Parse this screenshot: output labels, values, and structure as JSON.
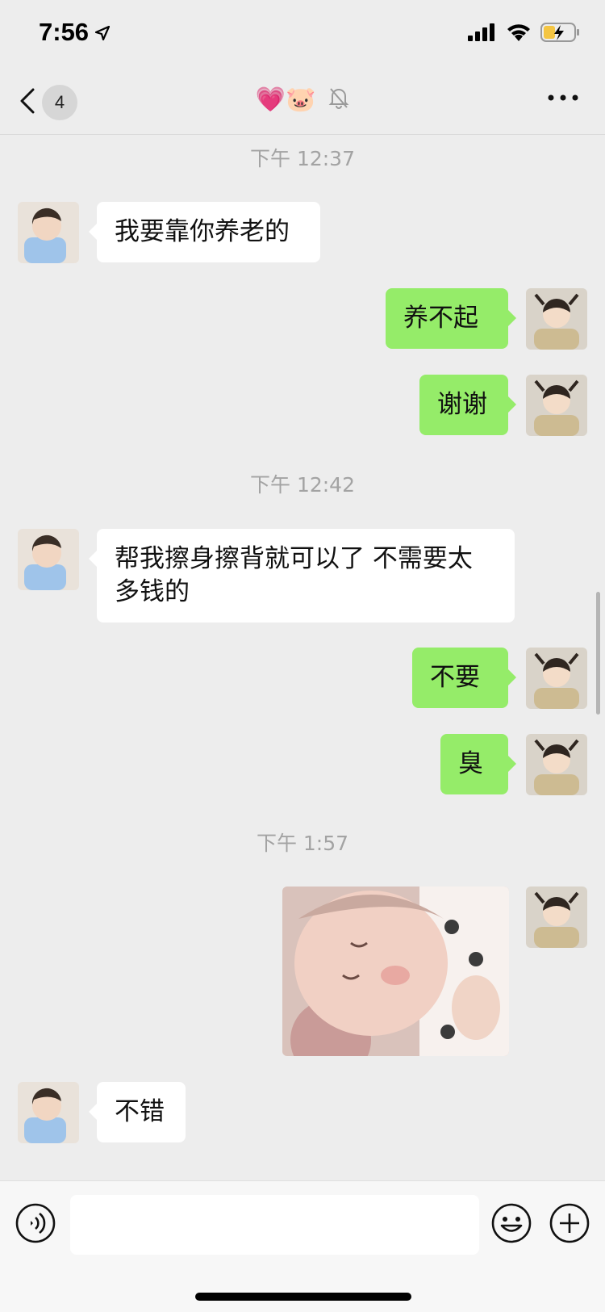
{
  "status_bar": {
    "time": "7:56"
  },
  "nav": {
    "unread_count": "4",
    "title": "💗🐷"
  },
  "messages": {
    "ts1": "下午 12:37",
    "m1": "我要靠你养老的",
    "m2": "养不起",
    "m3": "谢谢",
    "ts2": "下午 12:42",
    "m4": "帮我擦身擦背就可以了 不需要太多钱的",
    "m5": "不要",
    "m6": "臭",
    "ts3": "下午 1:57",
    "m8": "不错"
  },
  "input": {
    "value": ""
  },
  "colors": {
    "outgoing_bubble": "#95ec69",
    "incoming_bubble": "#ffffff",
    "background": "#ededed"
  },
  "icons": [
    "location-arrow-icon",
    "signal-icon",
    "wifi-icon",
    "battery-charging-icon",
    "back-chevron-icon",
    "mute-bell-icon",
    "more-icon",
    "voice-icon",
    "emoji-icon",
    "plus-icon"
  ]
}
